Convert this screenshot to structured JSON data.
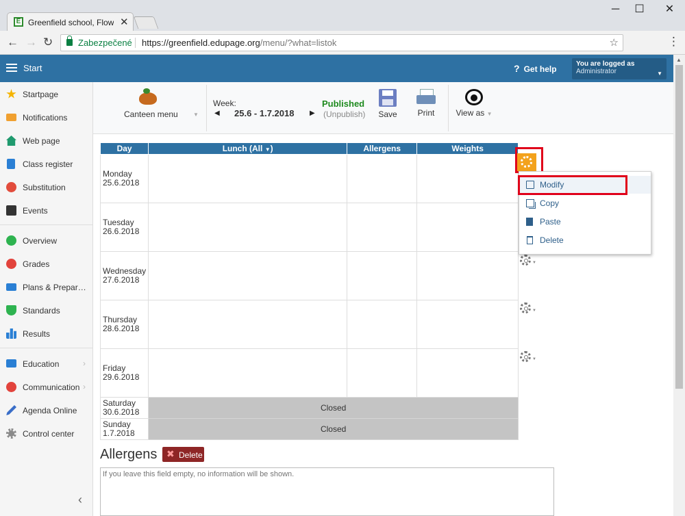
{
  "browser": {
    "tab_title": "Greenfield school, Flower",
    "tab_favicon_letter": "E",
    "secure_label": "Zabezpečené",
    "url_host": "https://greenfield.edupage.org",
    "url_path": "/menu/?what=listok"
  },
  "header": {
    "title": "Start",
    "help_label": "Get help",
    "account_line1": "You are logged as",
    "account_line2": "Administrator"
  },
  "sidebar": {
    "items": [
      {
        "label": "Startpage",
        "icon": "star-icon",
        "color": "#f5b400"
      },
      {
        "label": "Notifications",
        "icon": "envelope-icon",
        "color": "#f0a030"
      },
      {
        "label": "Web page",
        "icon": "home-icon",
        "color": "#1f9a6e"
      },
      {
        "label": "Class register",
        "icon": "book-icon",
        "color": "#2a7fd4"
      },
      {
        "label": "Substitution",
        "icon": "person-icon",
        "color": "#e24c3c"
      },
      {
        "label": "Events",
        "icon": "calendar-icon",
        "color": "#333333"
      },
      {
        "label": "Overview",
        "icon": "check-circle-icon",
        "color": "#2eb350"
      },
      {
        "label": "Grades",
        "icon": "grades-icon",
        "color": "#e2433c"
      },
      {
        "label": "Plans & Prepar…",
        "icon": "briefcase-icon",
        "color": "#2a7fd4"
      },
      {
        "label": "Standards",
        "icon": "shield-check-icon",
        "color": "#2eb350"
      },
      {
        "label": "Results",
        "icon": "bar-chart-icon",
        "color": "#2a7fd4"
      },
      {
        "label": "Education",
        "icon": "open-book-icon",
        "color": "#2a7fd4"
      },
      {
        "label": "Communication",
        "icon": "chat-icon",
        "color": "#e2433c"
      },
      {
        "label": "Agenda Online",
        "icon": "pen-icon",
        "color": "#3a6ec8"
      },
      {
        "label": "Control center",
        "icon": "gear-icon",
        "color": "#8a8a8a"
      }
    ]
  },
  "toolbar": {
    "canteen_label": "Canteen menu",
    "week_label": "Week:",
    "week_value": "25.6 - 1.7.2018",
    "published": "Published",
    "unpublish": "(Unpublish)",
    "save_label": "Save",
    "print_label": "Print",
    "viewas_label": "View as"
  },
  "table": {
    "headers": {
      "day": "Day",
      "lunch": "Lunch (All",
      "allergens": "Allergens",
      "weights": "Weights"
    },
    "days": [
      {
        "name": "Monday",
        "date": "25.6.2018"
      },
      {
        "name": "Tuesday",
        "date": "26.6.2018"
      },
      {
        "name": "Wednesday",
        "date": "27.6.2018"
      },
      {
        "name": "Thursday",
        "date": "28.6.2018"
      },
      {
        "name": "Friday",
        "date": "29.6.2018"
      },
      {
        "name": "Saturday",
        "date": "30.6.2018",
        "closed": "Closed"
      },
      {
        "name": "Sunday",
        "date": "1.7.2018",
        "closed": "Closed"
      }
    ]
  },
  "context_menu": {
    "items": [
      "Modify",
      "Copy",
      "Paste",
      "Delete"
    ]
  },
  "allergens": {
    "title": "Allergens",
    "delete_label": "Delete",
    "placeholder": "If you leave this field empty, no information will be shown."
  },
  "colors": {
    "header_bg": "#2e71a3",
    "gear_active": "#f3a21c",
    "highlight": "#e0001a",
    "published": "#1e8a1e",
    "closed_bg": "#c4c4c4"
  }
}
